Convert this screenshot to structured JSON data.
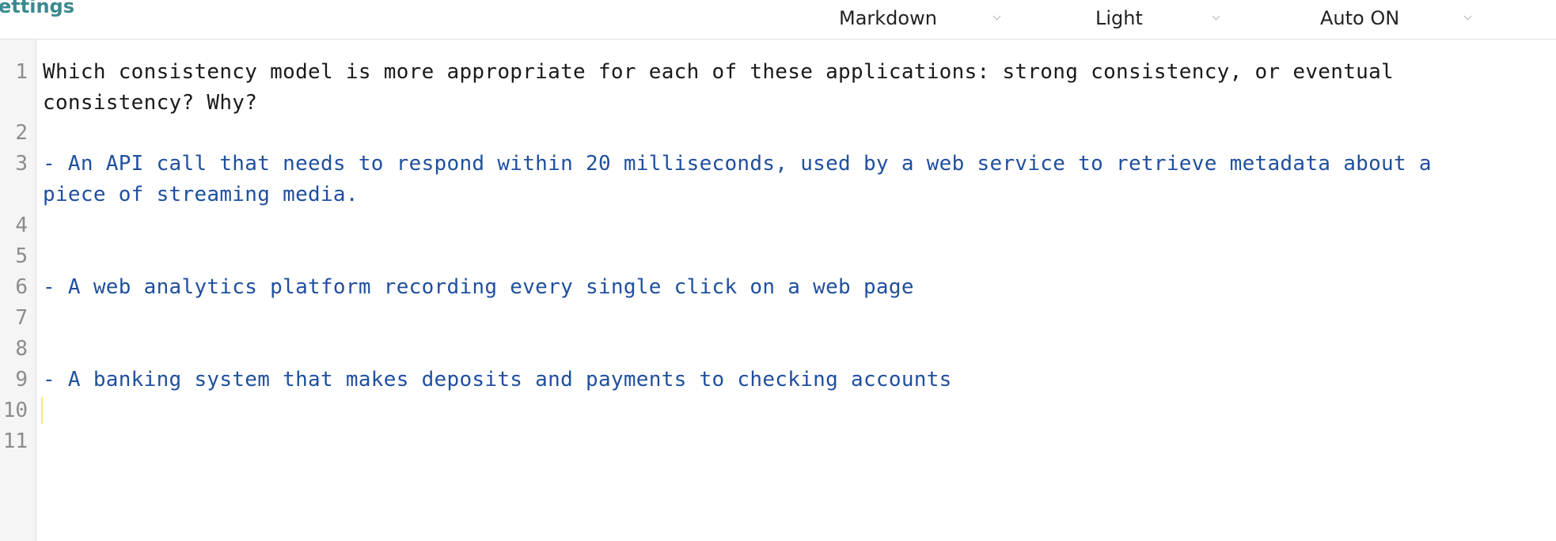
{
  "header": {
    "settings_label": "ettings",
    "dropdowns": {
      "language": "Markdown",
      "theme": "Light",
      "autosave": "Auto ON"
    }
  },
  "editor": {
    "line_numbers": [
      "1",
      "2",
      "3",
      "4",
      "5",
      "6",
      "7",
      "8",
      "9",
      "10",
      "11"
    ],
    "lines": {
      "l1a": "Which consistency model is more appropriate for each of these applications: strong consistency, or eventual",
      "l1b": "consistency? Why?",
      "l3a": "- An API call that needs to respond within 20 milliseconds, used by a web service to retrieve metadata about a",
      "l3b": "piece of streaming media.",
      "l6": "- A web analytics platform recording every single click on a web page",
      "l9": "- A banking system that makes deposits and payments to checking accounts"
    }
  },
  "colors": {
    "accent": "#3a8a8f",
    "list_text": "#1f4f9e",
    "cursor": "#f3e87a"
  }
}
